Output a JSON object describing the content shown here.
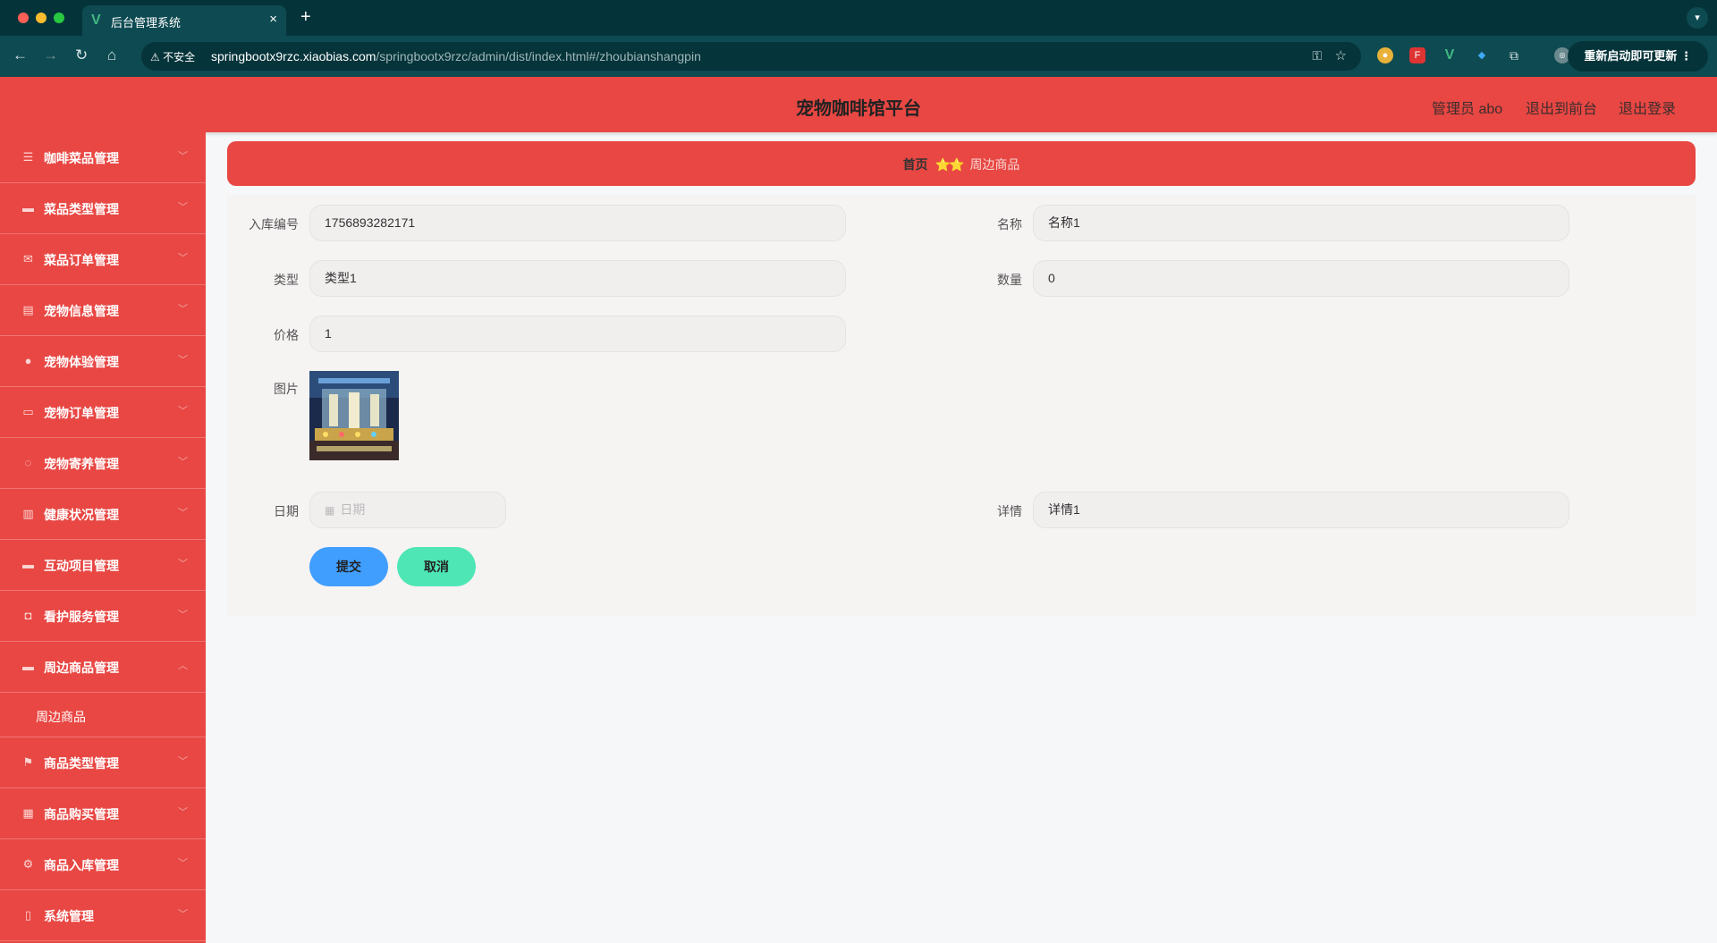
{
  "browser": {
    "tab_title": "后台管理系统",
    "tab_close": "×",
    "new_tab": "+",
    "insecure_label": "不安全",
    "url_host": "springbootx9rzc.xiaobias.com",
    "url_path": "/springbootx9rzc/admin/dist/index.html#/zhoubianshangpin",
    "update_label": "重新启动即可更新",
    "update_menu": "⋮"
  },
  "header": {
    "title": "宠物咖啡馆平台",
    "admin": "管理员 abo",
    "to_front": "退出到前台",
    "logout": "退出登录"
  },
  "sidebar": {
    "items": [
      {
        "label": "咖啡菜品管理",
        "icon": "list-icon"
      },
      {
        "label": "菜品类型管理",
        "icon": "monitor-icon"
      },
      {
        "label": "菜品订单管理",
        "icon": "mail-icon"
      },
      {
        "label": "宠物信息管理",
        "icon": "clipboard-icon"
      },
      {
        "label": "宠物体验管理",
        "icon": "user-icon"
      },
      {
        "label": "宠物订单管理",
        "icon": "ticket-icon"
      },
      {
        "label": "宠物寄养管理",
        "icon": "power-icon"
      },
      {
        "label": "健康状况管理",
        "icon": "doc-icon"
      },
      {
        "label": "互动项目管理",
        "icon": "chat-icon"
      },
      {
        "label": "看护服务管理",
        "icon": "camera-icon"
      },
      {
        "label": "周边商品管理",
        "icon": "box-icon"
      },
      {
        "label": "商品类型管理",
        "icon": "flag-icon"
      },
      {
        "label": "商品购买管理",
        "icon": "grid-icon"
      },
      {
        "label": "商品入库管理",
        "icon": "gear-icon"
      },
      {
        "label": "系统管理",
        "icon": "phone-icon"
      }
    ],
    "submenu_label": "周边商品"
  },
  "breadcrumb": {
    "home": "首页",
    "separator": "⭐⭐",
    "current": "周边商品"
  },
  "form": {
    "stock_no_label": "入库编号",
    "stock_no_value": "1756893282171",
    "name_label": "名称",
    "name_value": "名称1",
    "type_label": "类型",
    "type_value": "类型1",
    "qty_label": "数量",
    "qty_value": "0",
    "price_label": "价格",
    "price_value": "1",
    "image_label": "图片",
    "date_label": "日期",
    "date_placeholder": "日期",
    "detail_label": "详情",
    "detail_value": "详情1",
    "submit_label": "提交",
    "cancel_label": "取消"
  },
  "colors": {
    "primary": "#e84743",
    "submit": "#409eff",
    "cancel": "#4ee6b4"
  }
}
